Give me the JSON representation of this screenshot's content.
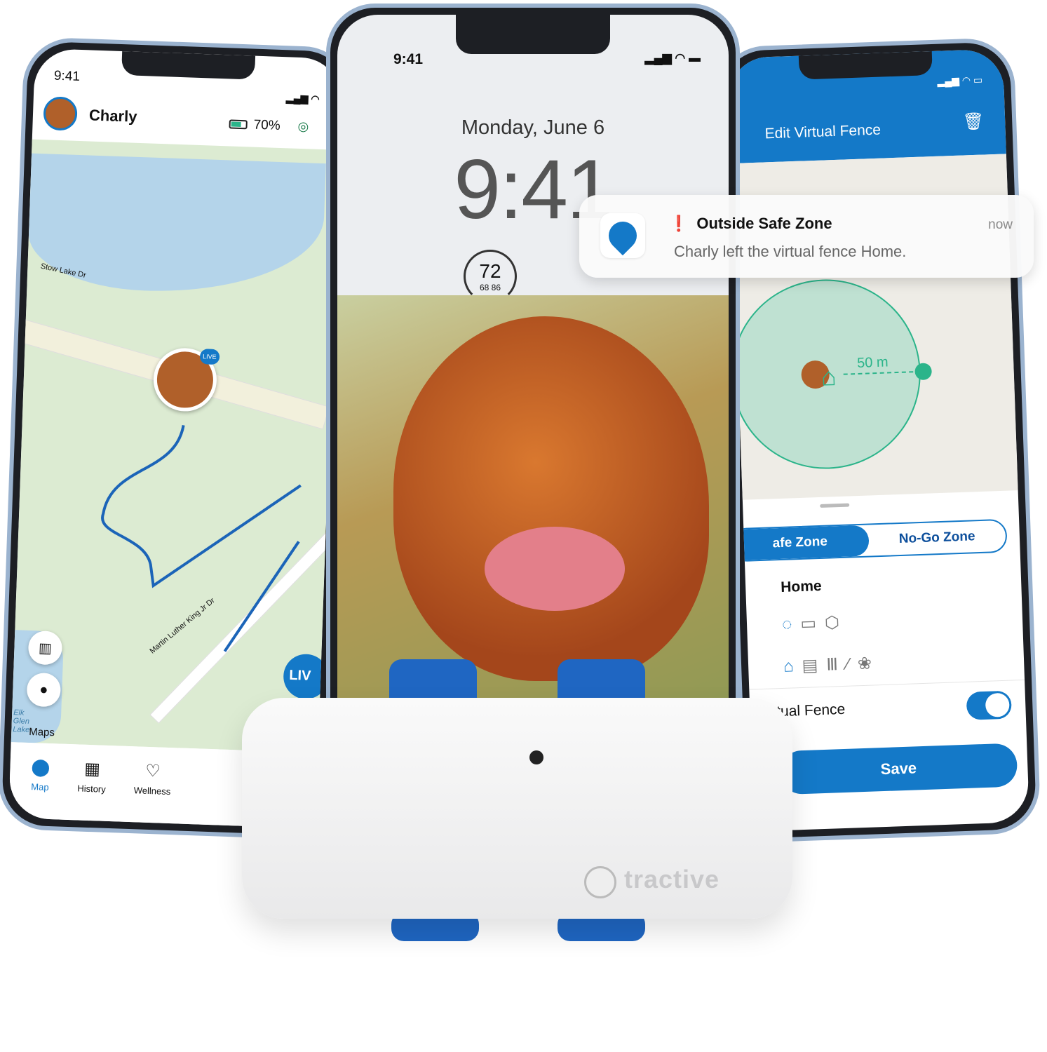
{
  "left_phone": {
    "status_time": "9:41",
    "pet_name": "Charly",
    "battery_percent": "70%",
    "battery_level": 0.7,
    "map": {
      "street_labels": [
        "Stow Lake Dr",
        "Martin Luther King Jr Dr"
      ],
      "lake_label": "Elk Glen Lake",
      "attribution": "Maps",
      "live_badge": "LIVE",
      "live_button": "LIV"
    },
    "nav": [
      {
        "label": "Map",
        "icon": "map-pin-icon",
        "active": true
      },
      {
        "label": "History",
        "icon": "calendar-icon"
      },
      {
        "label": "Wellness",
        "icon": "wellness-heart-icon"
      }
    ]
  },
  "center_phone": {
    "status_time": "9:41",
    "date": "Monday, June 6",
    "clock": "9:41",
    "weather": {
      "temp": "72",
      "low": "68",
      "high": "86"
    }
  },
  "notification": {
    "title": "Outside Safe Zone",
    "time": "now",
    "body": "Charly left the virtual fence Home."
  },
  "right_phone": {
    "header_title": "Edit Virtual Fence",
    "radius_label": "50 m",
    "segments": [
      "afe Zone",
      "No-Go Zone"
    ],
    "fence_name": "Home",
    "toggle_label": "e Virtual Fence",
    "toggle_on": true,
    "save_label": "Save"
  },
  "device": {
    "brand": "tractive"
  },
  "colors": {
    "accent": "#1479c8",
    "zone": "#2bb48a",
    "alert": "#e0202a"
  }
}
